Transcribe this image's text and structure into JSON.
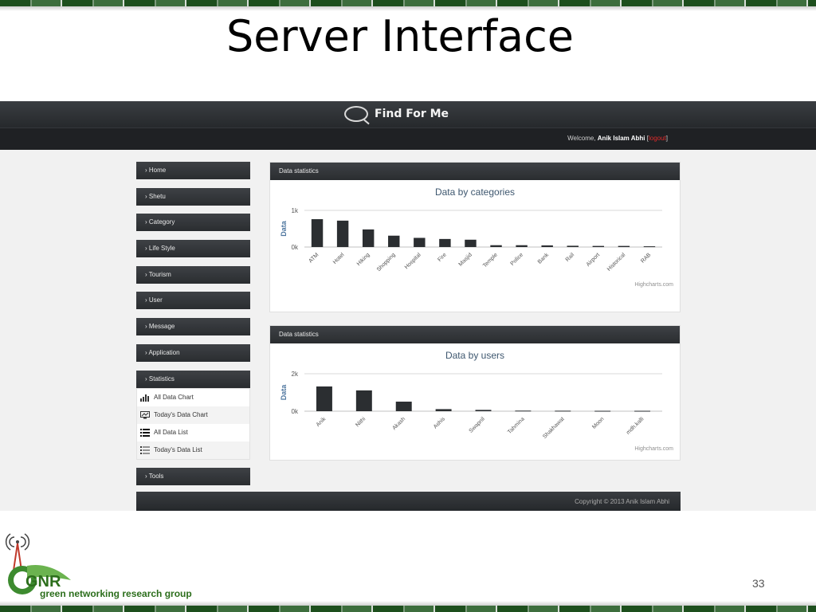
{
  "slide": {
    "title": "Server Interface",
    "page_number": "33",
    "org_logo_text": "green networking research group",
    "org_logo_mark": "GNR"
  },
  "app": {
    "brand": "Find For Me",
    "welcome_prefix": "Welcome,",
    "user_name": "Anik Islam Abhi",
    "logout_label": "logout",
    "copyright": "Copyright © 2013 Anik Islam Abhi"
  },
  "sidebar": {
    "items": [
      {
        "label": "› Home"
      },
      {
        "label": "› Shetu"
      },
      {
        "label": "› Category"
      },
      {
        "label": "› Life Style"
      },
      {
        "label": "› Tourism"
      },
      {
        "label": "› User"
      },
      {
        "label": "› Message"
      },
      {
        "label": "› Application"
      },
      {
        "label": "› Statistics"
      }
    ],
    "statistics_subitems": [
      {
        "label": "All Data Chart",
        "icon": "bar-chart-icon"
      },
      {
        "label": "Today's Data Chart",
        "icon": "monitor-chart-icon"
      },
      {
        "label": "All Data List",
        "icon": "list-icon"
      },
      {
        "label": "Today's Data List",
        "icon": "list-outline-icon"
      }
    ],
    "tools_label": "› Tools"
  },
  "panels": [
    {
      "header": "Data statistics"
    },
    {
      "header": "Data statistics"
    }
  ],
  "chart_data": [
    {
      "type": "bar",
      "title": "Data by categories",
      "ylabel": "Data",
      "yticks": [
        "1k",
        "0k"
      ],
      "ylim": [
        0,
        1000
      ],
      "categories": [
        "ATM",
        "Hotel",
        "Hiking",
        "Shopping",
        "Hospital",
        "Fire",
        "Masjid",
        "Temple",
        "Police",
        "Bank",
        "Rail",
        "Airport",
        "Historical",
        "RAB"
      ],
      "values": [
        760,
        720,
        480,
        310,
        250,
        220,
        200,
        50,
        50,
        45,
        35,
        30,
        30,
        20
      ],
      "credit": "Highcharts.com",
      "grid": true,
      "legend": "none",
      "color": "#2b2e31"
    },
    {
      "type": "bar",
      "title": "Data by users",
      "ylabel": "Data",
      "yticks": [
        "2k",
        "0k"
      ],
      "ylim": [
        0,
        2000
      ],
      "categories": [
        "Anik",
        "Nithi",
        "Akash",
        "Ashis",
        "Swapnil",
        "Tahmina",
        "Shakhawat",
        "Moon",
        "mdh.kalli"
      ],
      "values": [
        1320,
        1110,
        510,
        110,
        70,
        30,
        25,
        20,
        20
      ],
      "credit": "Highcharts.com",
      "grid": true,
      "legend": "none",
      "color": "#2b2e31"
    }
  ]
}
